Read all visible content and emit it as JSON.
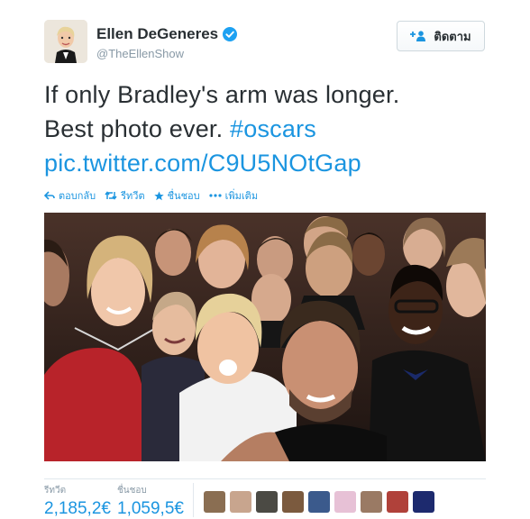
{
  "account": {
    "name": "Ellen DeGeneres",
    "handle": "@TheEllenShow",
    "follow_label": "ติดตาม"
  },
  "tweet": {
    "line1": "If only Bradley's arm was longer.",
    "line2_text": "Best photo ever. ",
    "hashtag": "#oscars",
    "pic_link": "pic.twitter.com/C9U5NOtGap"
  },
  "actions": {
    "reply": "ตอบกลับ",
    "retweet": "รีทวีต",
    "favorite": "ชื่นชอบ",
    "more": "เพิ่มเติม"
  },
  "stats": {
    "retweets_label": "รีทวีต",
    "retweets_value": "2,185,2€",
    "favorites_label": "ชื่นชอบ",
    "favorites_value": "1,059,5€"
  },
  "colors": {
    "link": "#1b95e0",
    "verified": "#1da1f2",
    "text": "#292f33",
    "muted": "#8899a6"
  },
  "favoriter_avatars": [
    "avatar-1",
    "avatar-2",
    "avatar-3",
    "avatar-4",
    "avatar-5",
    "avatar-6",
    "avatar-7",
    "avatar-8",
    "avatar-9"
  ]
}
